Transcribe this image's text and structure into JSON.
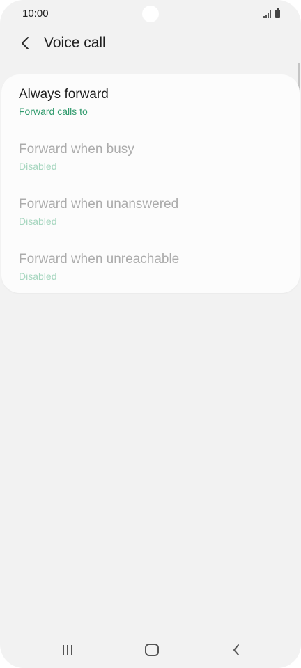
{
  "status_bar": {
    "time": "10:00",
    "icons": [
      "signal-icon",
      "battery-icon"
    ]
  },
  "header": {
    "back_icon": "chevron-left-icon",
    "title": "Voice call"
  },
  "list": {
    "items": [
      {
        "title": "Always forward",
        "subtitle": "Forward calls to",
        "enabled": true
      },
      {
        "title": "Forward when busy",
        "subtitle": "Disabled",
        "enabled": false
      },
      {
        "title": "Forward when unanswered",
        "subtitle": "Disabled",
        "enabled": false
      },
      {
        "title": "Forward when unreachable",
        "subtitle": "Disabled",
        "enabled": false
      }
    ]
  },
  "nav_bar": {
    "icons": [
      "recent-apps-icon",
      "home-icon",
      "back-icon"
    ]
  },
  "colors": {
    "background": "#f2f2f2",
    "card": "#fcfcfc",
    "accent": "#2f9a6c",
    "accent_disabled": "#a6d6bf",
    "text": "#1f1f1f",
    "text_disabled": "#ababab"
  }
}
